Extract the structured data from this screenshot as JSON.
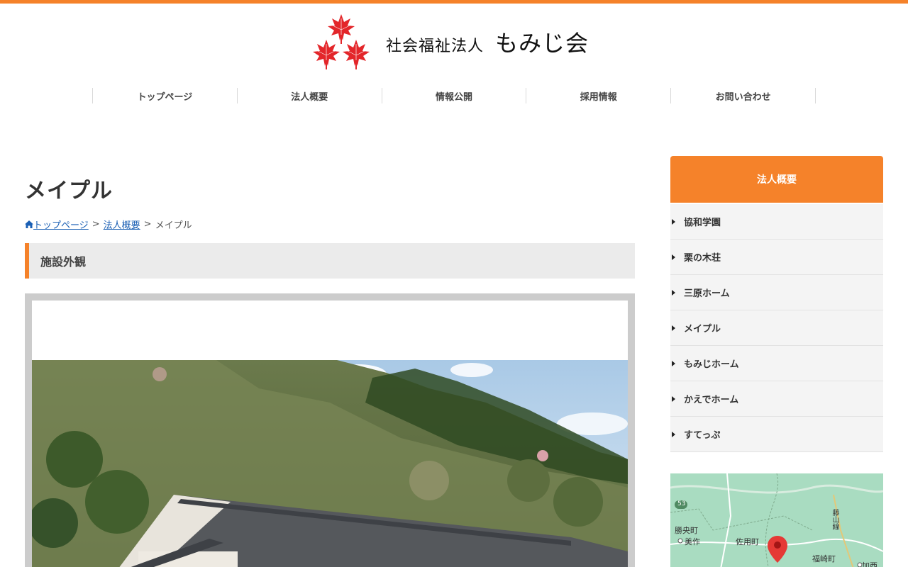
{
  "site": {
    "logo_sub": "社会福祉法人",
    "logo_main": "もみじ会",
    "accent_color": "#f5822a",
    "logo_icon": "maple-leaf-icon"
  },
  "nav": {
    "items": [
      {
        "label": "トップページ"
      },
      {
        "label": "法人概要"
      },
      {
        "label": "情報公開"
      },
      {
        "label": "採用情報"
      },
      {
        "label": "お問い合わせ"
      }
    ]
  },
  "main": {
    "title": "メイプル",
    "breadcrumb": {
      "home_icon": "home-icon",
      "home": "トップページ",
      "parent": "法人概要",
      "current": "メイプル",
      "separator": ">"
    },
    "section_heading": "施設外観"
  },
  "sidebar": {
    "heading": "法人概要",
    "items": [
      {
        "label": "協和学園"
      },
      {
        "label": "栗の木荘"
      },
      {
        "label": "三原ホーム"
      },
      {
        "label": "メイプル"
      },
      {
        "label": "もみじホーム"
      },
      {
        "label": "かえでホーム"
      },
      {
        "label": "すてっぷ"
      }
    ]
  },
  "map": {
    "labels": {
      "route": "53",
      "shoboku": "勝央町",
      "mimasaka": "美作",
      "sayo": "佐用町",
      "fukusaki": "福崎町",
      "kasai": "加西",
      "fujikawa": "藤山線"
    }
  }
}
